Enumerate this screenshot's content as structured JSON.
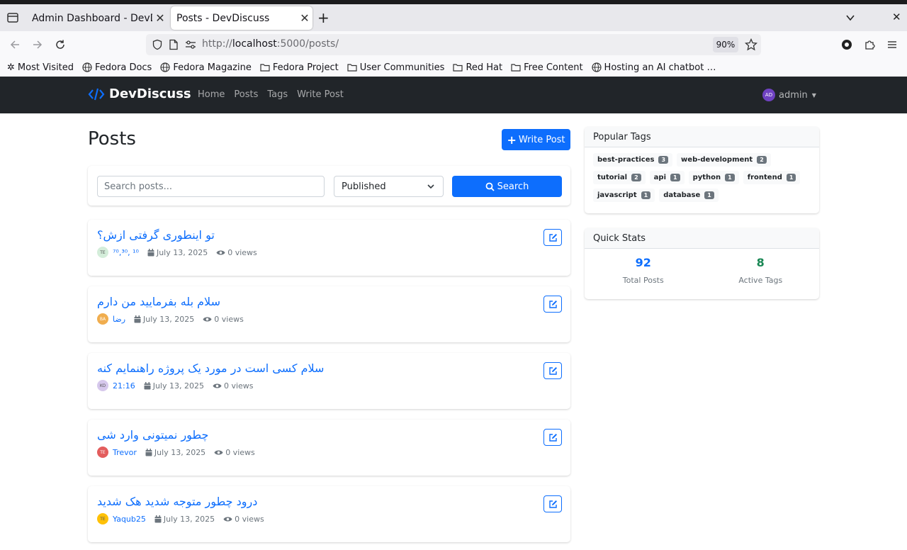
{
  "browser": {
    "tabs": [
      {
        "title": "Admin Dashboard - DevDiscuss",
        "active": false
      },
      {
        "title": "Posts - DevDiscuss",
        "active": true
      }
    ],
    "url_prefix": "http://",
    "url_host": "localhost",
    "url_rest": ":5000/posts/",
    "zoom": "90%",
    "bookmarks": [
      {
        "label": "Most Visited",
        "icon": "gear-icon"
      },
      {
        "label": "Fedora Docs",
        "icon": "globe-icon"
      },
      {
        "label": "Fedora Magazine",
        "icon": "globe-icon"
      },
      {
        "label": "Fedora Project",
        "icon": "folder-icon"
      },
      {
        "label": "User Communities",
        "icon": "folder-icon"
      },
      {
        "label": "Red Hat",
        "icon": "folder-icon"
      },
      {
        "label": "Free Content",
        "icon": "folder-icon"
      },
      {
        "label": "Hosting an AI chatbot …",
        "icon": "globe-icon"
      }
    ]
  },
  "site": {
    "brand": "DevDiscuss",
    "nav": [
      "Home",
      "Posts",
      "Tags",
      "Write Post"
    ],
    "user": {
      "initials": "AD",
      "name": "admin"
    }
  },
  "main": {
    "title": "Posts",
    "write_button": "Write Post",
    "search_placeholder": "Search posts...",
    "status_selected": "Published",
    "search_button": "Search"
  },
  "posts": [
    {
      "title": "تو اینطوری گرفتی ازش؟",
      "initials": "TE",
      "avatar_color": "#d4edda",
      "avatar_text_color": "#555",
      "author": "⁷⁰,³⁰, ¹⁰",
      "date": "July 13, 2025",
      "views": "0 views"
    },
    {
      "title": "سلام بله بفرمایید من دارم",
      "initials": "BA",
      "avatar_color": "#f0ad4e",
      "avatar_text_color": "#fff",
      "author": "رضا",
      "date": "July 13, 2025",
      "views": "0 views"
    },
    {
      "title": "سلام کسی است در مورد یک پروژه راهنمایم کنه",
      "initials": "KO",
      "avatar_color": "#d6c8ec",
      "avatar_text_color": "#555",
      "author": "21:16",
      "date": "July 13, 2025",
      "views": "0 views"
    },
    {
      "title": "چطور نمیتونی وارد شی",
      "initials": "TE",
      "avatar_color": "#e35d5d",
      "avatar_text_color": "#fff",
      "author": "Trevor",
      "date": "July 13, 2025",
      "views": "0 views"
    },
    {
      "title": "درود چطور متوجه شدید هک شدید",
      "initials": "TE",
      "avatar_color": "#ffc107",
      "avatar_text_color": "#555",
      "author": "Yaqub25",
      "date": "July 13, 2025",
      "views": "0 views"
    }
  ],
  "sidebar": {
    "popular_tags_title": "Popular Tags",
    "tags": [
      {
        "name": "best-practices",
        "count": "3"
      },
      {
        "name": "web-development",
        "count": "2"
      },
      {
        "name": "tutorial",
        "count": "2"
      },
      {
        "name": "api",
        "count": "1"
      },
      {
        "name": "python",
        "count": "1"
      },
      {
        "name": "frontend",
        "count": "1"
      },
      {
        "name": "javascript",
        "count": "1"
      },
      {
        "name": "database",
        "count": "1"
      }
    ],
    "quick_stats_title": "Quick Stats",
    "total_posts": "92",
    "total_posts_label": "Total Posts",
    "active_tags": "8",
    "active_tags_label": "Active Tags"
  },
  "colors": {
    "primary": "#0d6efd",
    "navbar": "#212529",
    "stat_posts": "#0d6efd",
    "stat_tags": "#198754"
  }
}
